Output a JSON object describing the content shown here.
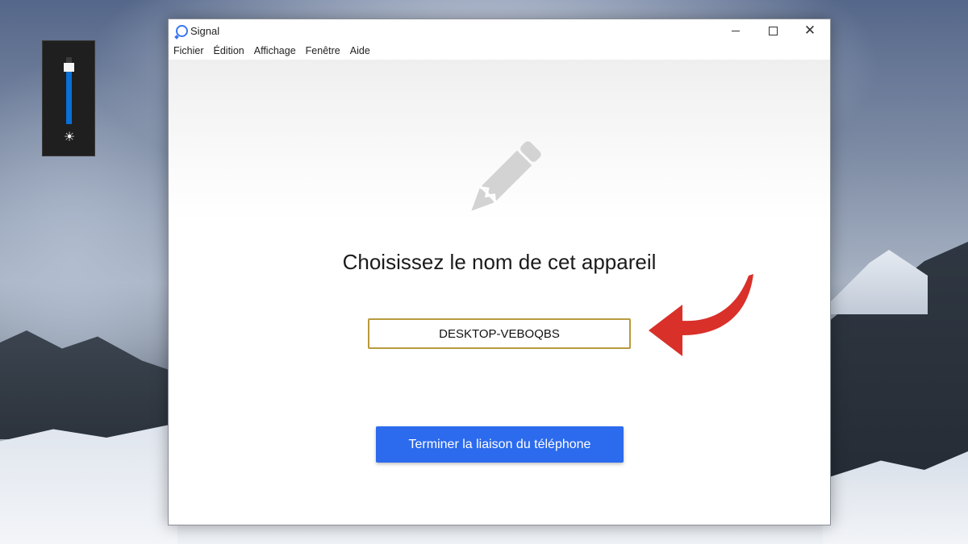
{
  "app": {
    "title": "Signal",
    "icon": "signal-logo-icon",
    "accent": "#2c6bed"
  },
  "window_controls": {
    "minimize_icon": "minimize-icon",
    "maximize_icon": "maximize-icon",
    "close_icon": "close-icon"
  },
  "menu": {
    "items": [
      {
        "label": "Fichier"
      },
      {
        "label": "Édition"
      },
      {
        "label": "Affichage"
      },
      {
        "label": "Fenêtre"
      },
      {
        "label": "Aide"
      }
    ]
  },
  "main": {
    "illustration_icon": "pencil-icon",
    "heading": "Choisissez le nom de cet appareil",
    "device_name_value": "DESKTOP-VEBOQBS",
    "finish_button_label": "Terminer la liaison du téléphone"
  },
  "brightness_flyout": {
    "level_percent": 85,
    "icon": "brightness-sun-icon",
    "fill_color": "#0a6fd6"
  },
  "annotation": {
    "icon": "curved-arrow-icon",
    "color": "#d9302a"
  }
}
